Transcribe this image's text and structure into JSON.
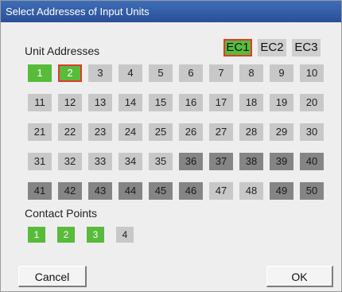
{
  "dialog": {
    "title": "Select Addresses of Input Units"
  },
  "unit_addresses": {
    "label": "Unit Addresses",
    "ec_tabs": [
      {
        "label": "EC1",
        "selected": true
      },
      {
        "label": "EC2",
        "selected": false
      },
      {
        "label": "EC3",
        "selected": false
      }
    ],
    "cells": [
      {
        "label": "1",
        "state": "green"
      },
      {
        "label": "2",
        "state": "green",
        "selected": true
      },
      {
        "label": "3",
        "state": "light"
      },
      {
        "label": "4",
        "state": "light"
      },
      {
        "label": "5",
        "state": "light"
      },
      {
        "label": "6",
        "state": "light"
      },
      {
        "label": "7",
        "state": "light"
      },
      {
        "label": "8",
        "state": "light"
      },
      {
        "label": "9",
        "state": "light"
      },
      {
        "label": "10",
        "state": "light"
      },
      {
        "label": "11",
        "state": "light"
      },
      {
        "label": "12",
        "state": "light"
      },
      {
        "label": "13",
        "state": "light"
      },
      {
        "label": "14",
        "state": "light"
      },
      {
        "label": "15",
        "state": "light"
      },
      {
        "label": "16",
        "state": "light"
      },
      {
        "label": "17",
        "state": "light"
      },
      {
        "label": "18",
        "state": "light"
      },
      {
        "label": "19",
        "state": "light"
      },
      {
        "label": "20",
        "state": "light"
      },
      {
        "label": "21",
        "state": "light"
      },
      {
        "label": "22",
        "state": "light"
      },
      {
        "label": "23",
        "state": "light"
      },
      {
        "label": "24",
        "state": "light"
      },
      {
        "label": "25",
        "state": "light"
      },
      {
        "label": "26",
        "state": "light"
      },
      {
        "label": "27",
        "state": "light"
      },
      {
        "label": "28",
        "state": "light"
      },
      {
        "label": "29",
        "state": "light"
      },
      {
        "label": "30",
        "state": "light"
      },
      {
        "label": "31",
        "state": "light"
      },
      {
        "label": "32",
        "state": "light"
      },
      {
        "label": "33",
        "state": "light"
      },
      {
        "label": "34",
        "state": "light"
      },
      {
        "label": "35",
        "state": "light"
      },
      {
        "label": "36",
        "state": "dark"
      },
      {
        "label": "37",
        "state": "dark"
      },
      {
        "label": "38",
        "state": "dark"
      },
      {
        "label": "39",
        "state": "dark"
      },
      {
        "label": "40",
        "state": "dark"
      },
      {
        "label": "41",
        "state": "dark"
      },
      {
        "label": "42",
        "state": "dark"
      },
      {
        "label": "43",
        "state": "dark"
      },
      {
        "label": "44",
        "state": "dark"
      },
      {
        "label": "45",
        "state": "dark"
      },
      {
        "label": "46",
        "state": "dark"
      },
      {
        "label": "47",
        "state": "light"
      },
      {
        "label": "48",
        "state": "light"
      },
      {
        "label": "49",
        "state": "dark"
      },
      {
        "label": "50",
        "state": "dark"
      }
    ]
  },
  "contact_points": {
    "label": "Contact Points",
    "items": [
      {
        "label": "1",
        "state": "green"
      },
      {
        "label": "2",
        "state": "green"
      },
      {
        "label": "3",
        "state": "green"
      },
      {
        "label": "4",
        "state": "light"
      }
    ]
  },
  "buttons": {
    "cancel": "Cancel",
    "ok": "OK"
  },
  "colors": {
    "title_bar": "#2f5ba6",
    "active": "#58bb3a",
    "selection_border": "#e03a2a",
    "inactive_light": "#c8c8c8",
    "inactive_dark": "#858585"
  }
}
